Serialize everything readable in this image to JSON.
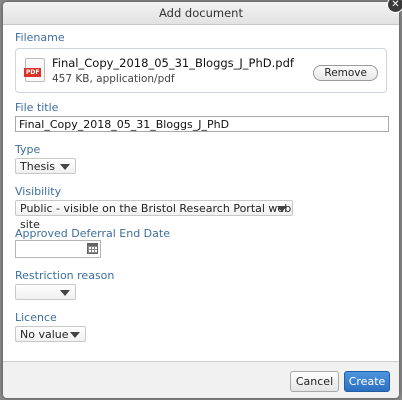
{
  "dialog": {
    "title": "Add document",
    "close_glyph": "✕"
  },
  "filename": {
    "label": "Filename",
    "file_name": "Final_Copy_2018_05_31_Bloggs_J_PhD.pdf",
    "file_meta": "457 KB, application/pdf",
    "icon": "pdf-file-icon",
    "icon_badge": "PDF",
    "remove_label": "Remove"
  },
  "file_title": {
    "label": "File title",
    "value": "Final_Copy_2018_05_31_Bloggs_J_PhD"
  },
  "type": {
    "label": "Type",
    "value": "Thesis"
  },
  "visibility": {
    "label": "Visibility",
    "value": "Public - visible on the Bristol Research Portal web site"
  },
  "deferral": {
    "label": "Approved Deferral End Date",
    "value": "",
    "icon": "calendar-icon"
  },
  "restriction": {
    "label": "Restriction reason",
    "value": ""
  },
  "licence": {
    "label": "Licence",
    "value": "No value"
  },
  "footer": {
    "cancel_label": "Cancel",
    "create_label": "Create"
  },
  "colors": {
    "label_blue": "#3d6ea0",
    "primary_button": "#2c6fbf",
    "pdf_red": "#d9342b"
  }
}
